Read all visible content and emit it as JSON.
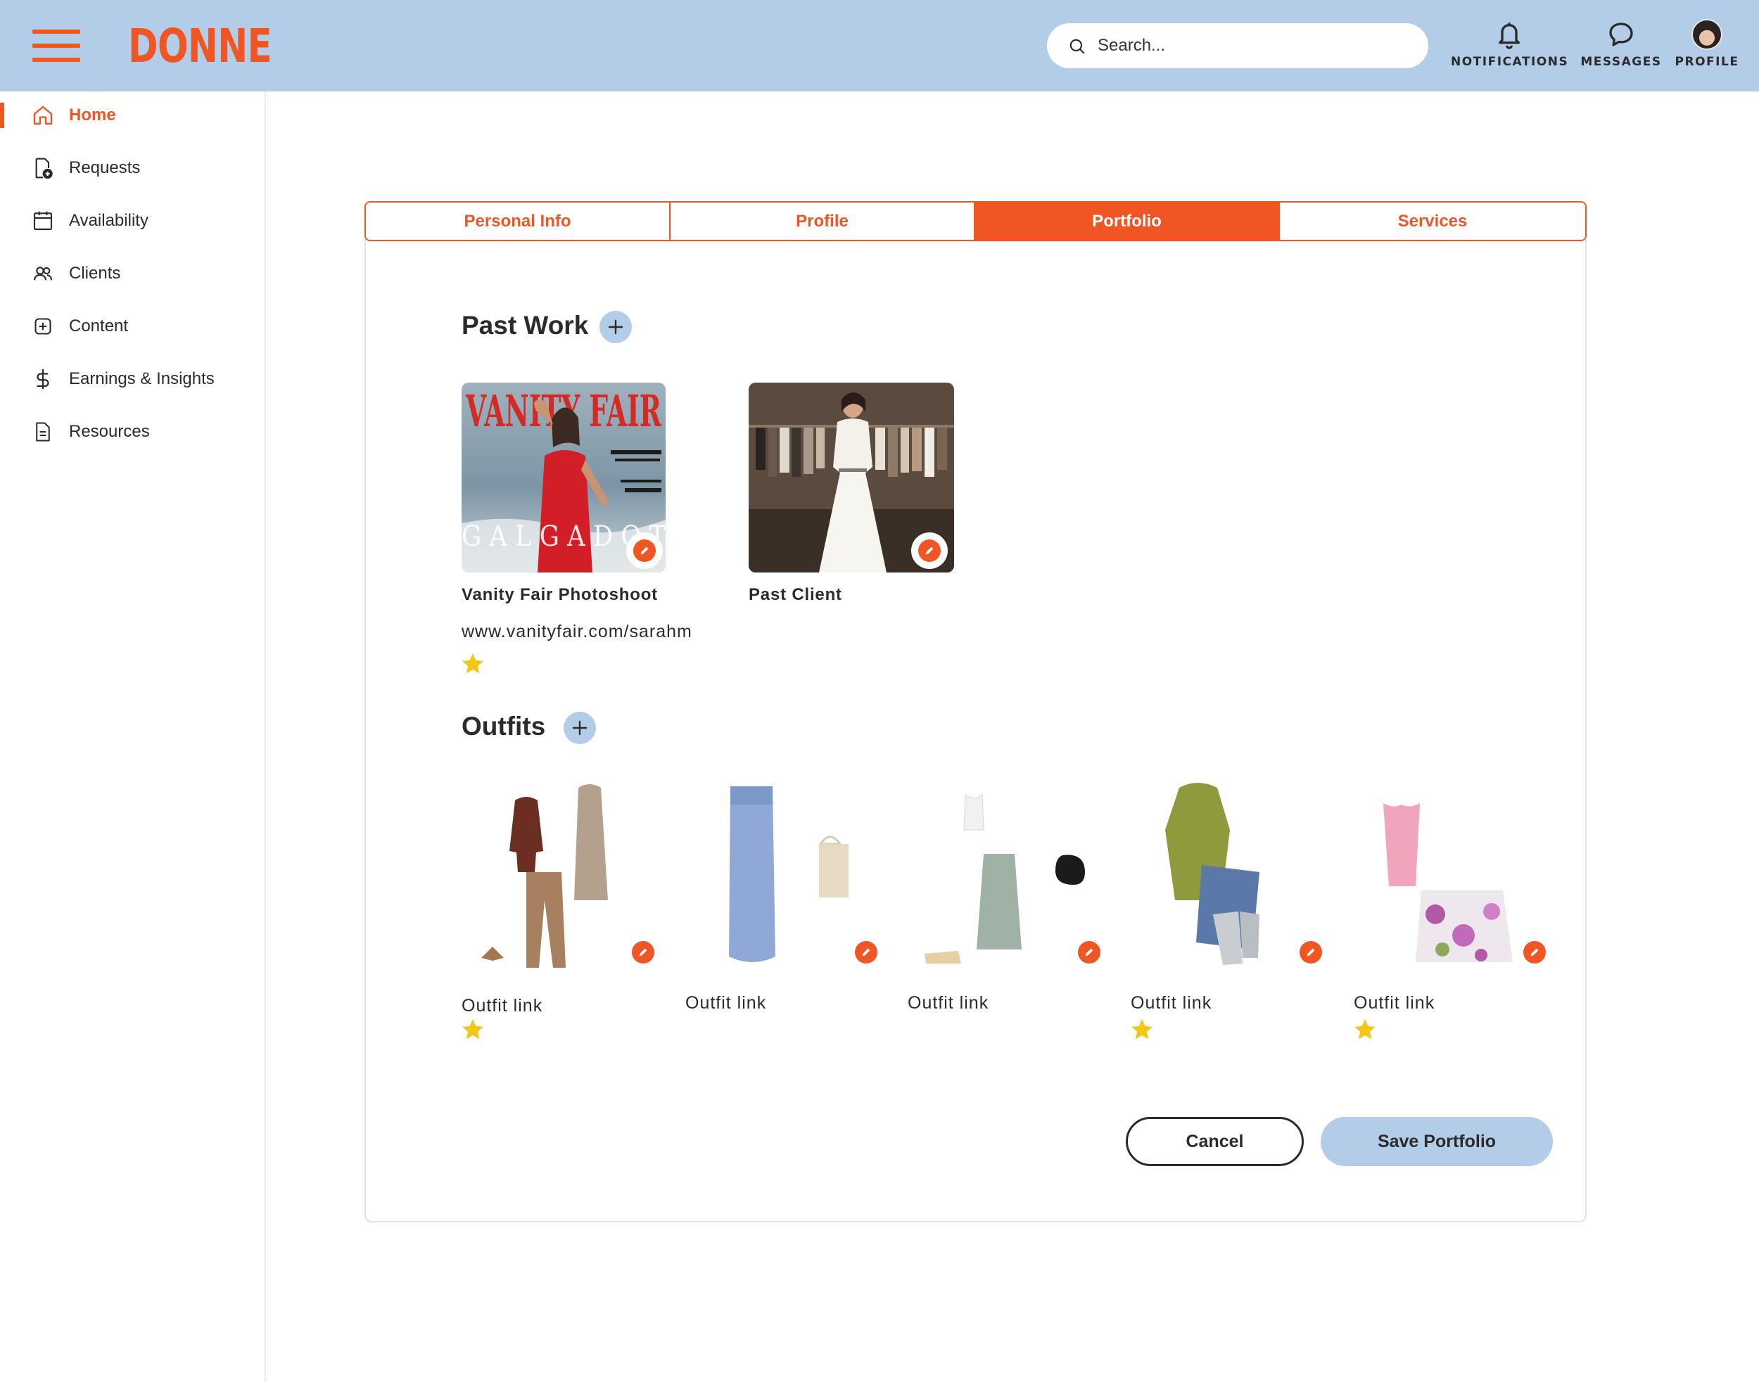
{
  "app": {
    "logo": "DONNE"
  },
  "header": {
    "search_placeholder": "Search...",
    "notifications_label": "NOTIFICATIONS",
    "messages_label": "MESSAGES",
    "profile_label": "PROFILE"
  },
  "sidebar": {
    "items": [
      {
        "label": "Home",
        "icon": "home-icon",
        "active": true
      },
      {
        "label": "Requests",
        "icon": "document-add-icon"
      },
      {
        "label": "Availability",
        "icon": "calendar-icon"
      },
      {
        "label": "Clients",
        "icon": "users-icon"
      },
      {
        "label": "Content",
        "icon": "plus-square-icon"
      },
      {
        "label": "Earnings & Insights",
        "icon": "dollar-icon"
      },
      {
        "label": "Resources",
        "icon": "file-text-icon"
      }
    ]
  },
  "tabs": [
    {
      "label": "Personal Info"
    },
    {
      "label": "Profile"
    },
    {
      "label": "Portfolio",
      "active": true
    },
    {
      "label": "Services"
    }
  ],
  "past_work": {
    "title": "Past Work",
    "items": [
      {
        "image_text": "VANITY FAIR",
        "title": "Vanity Fair Photoshoot",
        "link": "www.vanityfair.com/sarahm",
        "starred": true
      },
      {
        "title": "Past Client",
        "starred": false
      }
    ]
  },
  "outfits": {
    "title": "Outfits",
    "items": [
      {
        "label": "Outfit link",
        "starred": true
      },
      {
        "label": "Outfit link",
        "starred": false
      },
      {
        "label": "Outfit link",
        "starred": false
      },
      {
        "label": "Outfit link",
        "starred": true
      },
      {
        "label": "Outfit link",
        "starred": true
      }
    ]
  },
  "actions": {
    "cancel_label": "Cancel",
    "save_label": "Save Portfolio"
  },
  "colors": {
    "accent": "#ef5623",
    "header_bg": "#b3cde8",
    "star": "#f5c518"
  }
}
